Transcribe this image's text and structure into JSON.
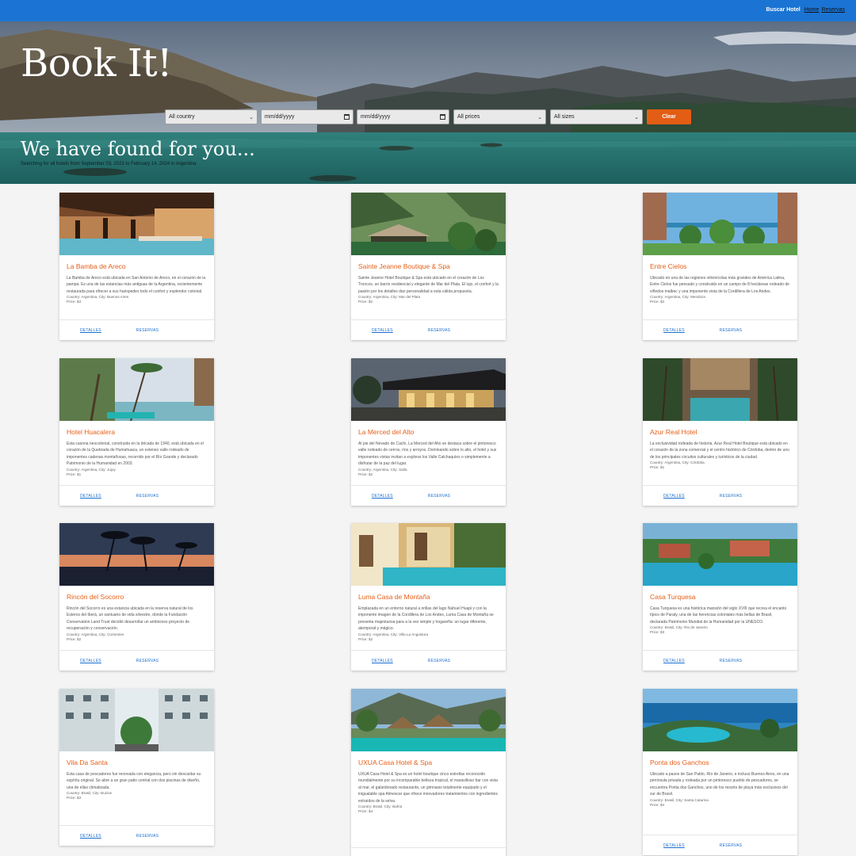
{
  "nav": {
    "brand": "Buscar Hotel",
    "home": "Home",
    "reservas": "Reservas"
  },
  "hero": {
    "title": "Book It!",
    "subtitle": "We have found for you...",
    "summary": "Searching for all hotels from September 03, 2023 to February 14, 2024 in Argentina"
  },
  "filters": {
    "country": "All country",
    "date_from": "mm/dd/yyyy",
    "date_to": "mm/dd/yyyy",
    "prices": "All prices",
    "sizes": "All sizes",
    "clear": "Clear"
  },
  "card_actions": {
    "detalles": "DETALLES",
    "reservas": "RESERVAS"
  },
  "hotels": [
    {
      "name": "La Bamba de Areco",
      "description": "La Bamba de Areco está ubicada en San Antonio de Areco, en el corazón de la pampa. Es una de las estancias más antiguas de la Argentina, recientemente restaurada para ofrecer a sus huéspedes todo el confort y esplendor colonial.",
      "location": "Country: Argentina, City: Buenos Aires",
      "price": "Price: $4",
      "image": "colonial-lounge-pool"
    },
    {
      "name": "Sainte Jeanne Boutique & Spa",
      "description": "Sainte Jeanne Hotel Boutique & Spa está ubicado en el corazón de Los Troncos, un barrio residencial y elegante de Mar del Plata. El lujo, el confort y la pasión por los detalles dan personalidad a esta cálida propuesta.",
      "location": "Country: Argentina, City: Mar del Plata",
      "price": "Price: $2",
      "image": "jungle-resort"
    },
    {
      "name": "Entre Cielos",
      "description": "Ubicado en una de las regiones vitivinícolas más grandes de América Latina, Entre Cielos fue pensado y construido en un campo de 8 hectáreas rodeado de viñedos malbec y una imponente vista de la Cordillera de Los Andes.",
      "location": "Country: Argentina, City: Mendoza",
      "price": "Price: $4",
      "image": "tropical-towers"
    },
    {
      "name": "Hotel Huacalera",
      "description": "Esta casona neocolonial, construida en la década de 1940, está ubicada en el corazón de la Quebrada de Humahuaca, un extenso valle rodeado de imponentes cadenas montañosas, recorrido por el Río Grande y declarado Patrimonio de la Humanidad en 2003.",
      "location": "Country: Argentina, City: Jujuy",
      "price": "Price: $1",
      "image": "beach-palms"
    },
    {
      "name": "La Merced del Alto",
      "description": "Al pie del Nevado de Cachi, La Merced del Alto se destaca sobre el pintoresco valle rodeado de cerros, ríos y arroyos. Dominando sobre lo alto, el hotel y sus imponentes vistas invitan a explorar los Valle Calchaquíes o simplemente a disfrutar de la paz del lugar.",
      "location": "Country: Argentina, City: Salta",
      "price": "Price: $2",
      "image": "modern-lodge-night"
    },
    {
      "name": "Azur Real Hotel",
      "description": "La exclusividad rodeada de historia. Azur Real Hotel Boutique está ubicado en el corazón de la zona comercial y el centro histórico de Córdoba, dentro de uno de los principales circuitos culturales y turísticos de la ciudad.",
      "location": "Country: Argentina, City: Córdoba",
      "price": "Price: $1",
      "image": "courtyard-pool"
    },
    {
      "name": "Rincón del Socorro",
      "description": "Rincón del Socorro es una estancia ubicada en la reserva natural de los Esteros del Iberá, un santuario de vida silvestre, donde la Fundación Conservation Land Trust decidió desarrollar un ambicioso proyecto de recuperación y conservación.",
      "location": "Country: Argentina, City: Corrientes",
      "price": "Price: $2",
      "image": "sunset-palms"
    },
    {
      "name": "Luma Casa de Montaña",
      "description": "Emplazada en un entorno natural a orillas del lago Nahuel Huapi y con la imponente imagen de la Cordillera de Los Andes, Luma Casa de Montaña se presenta majestuosa para a la vez simple y hogareña: un lugar diferente, atemporal y mágico.",
      "location": "Country: Argentina, City: Villa La Angostura",
      "price": "Price: $2",
      "image": "villa-pool"
    },
    {
      "name": "Casa Turquesa",
      "description": "Casa Turquesa es una histórica mansión del siglo XVIII que recrea el encanto típico de Paraty, una de las herencias coloniales más bellas de Brasil, declarada Patrimonio Mundial de la Humanidad por la UNESCO.",
      "location": "Country: Brasil, City: Rio de Janeiro",
      "price": "Price: $3",
      "image": "resort-pools"
    },
    {
      "name": "Vila Da Santa",
      "description": "Esta casa de pescadores fue renovada con elegancia, pero sin descuidar su espíritu original. Se abre a un gran patio central con dos piscinas de diseño, una de ellas climatizada.",
      "location": "Country: Brasil, City: Buzios",
      "price": "Price: $3",
      "image": "white-building"
    },
    {
      "name": "UXUA Casa Hotel & Spa",
      "description": "UXUA Casa Hotel & Spa es un hotel boutique cinco estrellas reconocido mundialmente por su incomparable belleza tropical, el maravilloso bar con vista al mar, el galardonado restaurante, un gimnasio totalmente equipado y el inigualable spa Almescar que ofrece innovadores tratamientos con ingredientes extraídos de la selva.",
      "location": "Country: Brasil, City: Bahía",
      "price": "Price: $4",
      "image": "thatched-pool"
    },
    {
      "name": "Ponta dos Ganchos",
      "description": "Ubicado a pasos de San Pablo, Río de Janeiro, e incluso Buenos Aires, en una península privada y rodeada por un pintoresco pueblo de pescadores, se encuentra Ponta dos Ganchos, uno de los resorts de playa más exclusivos del sur de Brasil.",
      "location": "Country: Brasil, City: Santa Catarina",
      "price": "Price: $4",
      "image": "ocean-cliff-pool"
    }
  ]
}
